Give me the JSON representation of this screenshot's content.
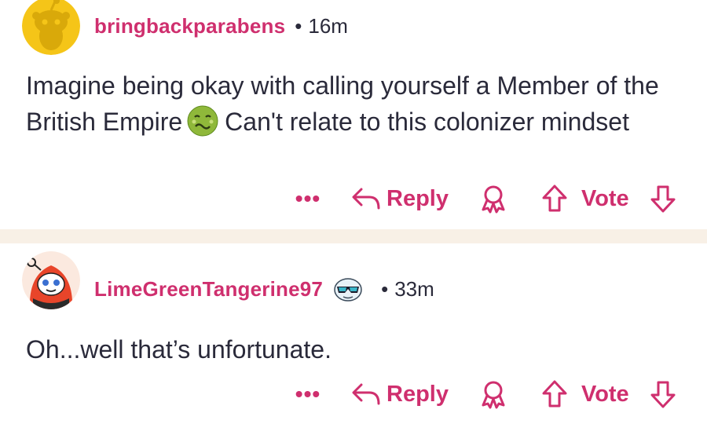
{
  "comments": [
    {
      "username": "bringbackparabens",
      "separator": "•",
      "time": "16m",
      "avatar_icon": "snoo-avatar-yellow",
      "text_before_emoji": "Imagine being okay with calling yourself a Member of the British Empire",
      "emoji_icon": "nauseated-face-icon",
      "text_after_emoji": "Can't relate to this colonizer mindset",
      "actions": {
        "more": "•••",
        "reply": "Reply",
        "vote": "Vote"
      }
    },
    {
      "username": "LimeGreenTangerine97",
      "flair_icon": "sunglasses-snoo-icon",
      "separator": "•",
      "time": "33m",
      "avatar_icon": "snoo-avatar-orange-hood",
      "text": "Oh...well that’s unfortunate.",
      "actions": {
        "more": "•••",
        "reply": "Reply",
        "vote": "Vote"
      }
    }
  ],
  "colors": {
    "accent": "#cf2f6e",
    "text": "#2a2a3a",
    "separator": "#f8f0e6",
    "avatar1_bg": "#f5c518",
    "avatar2_bg": "#e8452a"
  }
}
